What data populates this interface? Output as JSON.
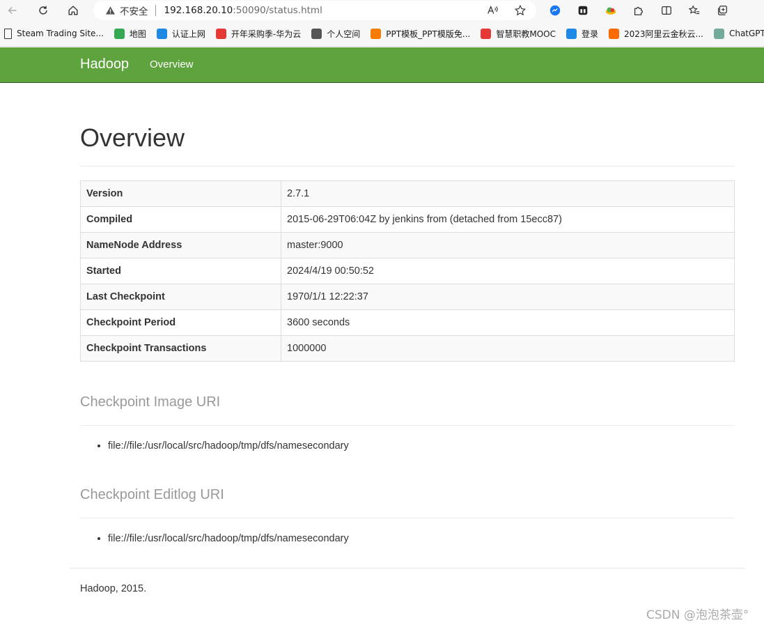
{
  "browser": {
    "security_label": "不安全",
    "url_host": "192.168.20.10",
    "url_rest": ":50090/status.html"
  },
  "bookmarks": [
    {
      "label": "Steam Trading Site...",
      "color": "#ffffff"
    },
    {
      "label": "地图",
      "color": "#34a853"
    },
    {
      "label": "认证上网",
      "color": "#1e88e5"
    },
    {
      "label": "开年采购季-华为云",
      "color": "#e53935"
    },
    {
      "label": "个人空间",
      "color": "#555555"
    },
    {
      "label": "PPT模板_PPT模版免...",
      "color": "#f57c00"
    },
    {
      "label": "智慧职教MOOC",
      "color": "#e53935"
    },
    {
      "label": "登录",
      "color": "#1e88e5"
    },
    {
      "label": "2023阿里云金秋云...",
      "color": "#ff6a00"
    },
    {
      "label": "ChatGPT",
      "color": "#74aa9c"
    }
  ],
  "navbar": {
    "brand": "Hadoop",
    "link": "Overview",
    "color": "#5fa33e"
  },
  "main": {
    "title": "Overview",
    "info": [
      {
        "key": "Version",
        "value": "2.7.1"
      },
      {
        "key": "Compiled",
        "value": "2015-06-29T06:04Z by jenkins from (detached from 15ecc87)"
      },
      {
        "key": "NameNode Address",
        "value": "master:9000"
      },
      {
        "key": "Started",
        "value": "2024/4/19 00:50:52"
      },
      {
        "key": "Last Checkpoint",
        "value": "1970/1/1 12:22:37"
      },
      {
        "key": "Checkpoint Period",
        "value": "3600 seconds"
      },
      {
        "key": "Checkpoint Transactions",
        "value": "1000000"
      }
    ],
    "image_uri_heading": "Checkpoint Image URI",
    "image_uris": [
      "file://file:/usr/local/src/hadoop/tmp/dfs/namesecondary"
    ],
    "editlog_uri_heading": "Checkpoint Editlog URI",
    "editlog_uris": [
      "file://file:/usr/local/src/hadoop/tmp/dfs/namesecondary"
    ]
  },
  "footer": "Hadoop, 2015.",
  "watermark": "CSDN @泡泡茶壶°"
}
